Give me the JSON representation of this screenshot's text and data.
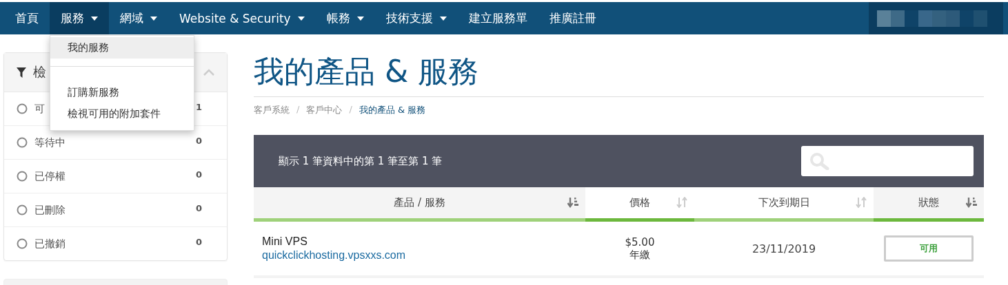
{
  "nav": {
    "items": [
      {
        "label": "首頁",
        "dropdown": false,
        "selected": false
      },
      {
        "label": "服務",
        "dropdown": true,
        "selected": true
      },
      {
        "label": "網域",
        "dropdown": true,
        "selected": false
      },
      {
        "label": "Website & Security",
        "dropdown": true,
        "selected": false
      },
      {
        "label": "帳務",
        "dropdown": true,
        "selected": false
      },
      {
        "label": "技術支援",
        "dropdown": true,
        "selected": false
      },
      {
        "label": "建立服務單",
        "dropdown": false,
        "selected": false
      },
      {
        "label": "推廣註冊",
        "dropdown": false,
        "selected": false
      }
    ],
    "dropdown_menu": {
      "groups": [
        [
          {
            "label": "我的服務",
            "selected": true
          }
        ],
        [
          {
            "label": "訂購新服務",
            "selected": false
          },
          {
            "label": "檢視可用的附加套件",
            "selected": false
          }
        ]
      ]
    }
  },
  "sidebar": {
    "filter_panel": {
      "title": "檢",
      "expanded": true,
      "items": [
        {
          "label": "可",
          "count": "1",
          "checked": false
        },
        {
          "label": "等待中",
          "count": "0",
          "checked": false
        },
        {
          "label": "已停權",
          "count": "0",
          "checked": false
        },
        {
          "label": "已刪除",
          "count": "0",
          "checked": false
        },
        {
          "label": "已撤銷",
          "count": "0",
          "checked": false
        }
      ]
    }
  },
  "page": {
    "title": "我的產品 & 服務",
    "breadcrumb": [
      {
        "kind": "link",
        "label": "客戶系統",
        "selected": false
      },
      {
        "kind": "separator",
        "label": "/"
      },
      {
        "kind": "link",
        "label": "客戶中心",
        "selected": false
      },
      {
        "kind": "separator",
        "label": "/"
      },
      {
        "kind": "link",
        "label": "我的產品 & 服務",
        "selected": true
      }
    ]
  },
  "table": {
    "info": "顯示 1 筆資料中的第 1 筆至第 1 筆",
    "columns": [
      {
        "label": "產品 / 服務",
        "sorted": true,
        "color": "#9fd17a"
      },
      {
        "label": "價格",
        "sorted": false,
        "color": "#6cb83d"
      },
      {
        "label": "下次到期日",
        "sorted": false,
        "color": "#9fd17a"
      },
      {
        "label": "狀態",
        "sorted": true,
        "color": "#6cb83d"
      }
    ],
    "rows": [
      {
        "product": "Mini VPS",
        "domain": "quickclickhosting.vpsxxs.com",
        "price": "$5.00",
        "cycle": "年繳",
        "due": "23/11/2019",
        "status": {
          "label": "可用",
          "color": "#3ca03c"
        }
      }
    ]
  }
}
